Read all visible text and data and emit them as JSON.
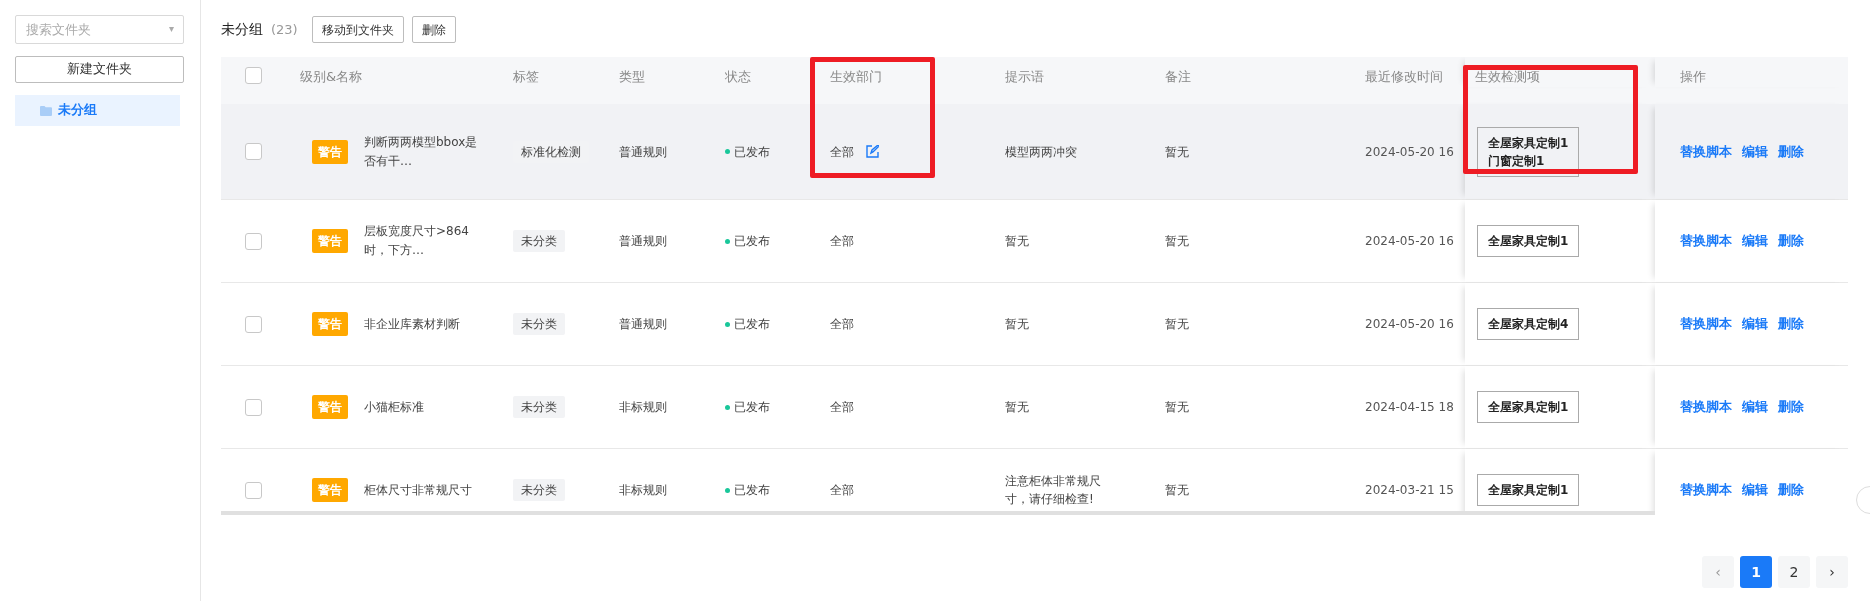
{
  "sidebar": {
    "search": {
      "placeholder": "搜索文件夹",
      "caret": "▾"
    },
    "new_folder_button": "新建文件夹",
    "folders": [
      {
        "label": "未分组",
        "selected": true
      }
    ]
  },
  "toolbar": {
    "title": "未分组",
    "count": "(23)",
    "buttons": [
      "移动到文件夹",
      "删除"
    ]
  },
  "table": {
    "select_all_checked": false,
    "columns": [
      {
        "label": "级别&名称",
        "highlighted": false
      },
      {
        "label": "标签",
        "highlighted": false
      },
      {
        "label": "类型",
        "highlighted": false
      },
      {
        "label": "状态",
        "highlighted": false
      },
      {
        "label": "生效部门",
        "highlighted": true
      },
      {
        "label": "提示语",
        "highlighted": false
      },
      {
        "label": "备注",
        "highlighted": false
      },
      {
        "label": "最近修改时间",
        "highlighted": false
      },
      {
        "label": "生效检测项",
        "highlighted": true
      },
      {
        "label": "操作",
        "highlighted": false
      }
    ],
    "rows": [
      {
        "checked": false,
        "hovered": true,
        "level": "警告",
        "name": "判断两两模型bbox是否有干…",
        "tag": "标准化检测",
        "type": "普通规则",
        "status": "已发布",
        "department": "全部",
        "department_editable": true,
        "tip": "模型两两冲突",
        "note": "暂无",
        "time": "2024-05-20 16",
        "detect_items": [
          "全屋家具定制1",
          "门窗定制1"
        ],
        "actions": [
          "替换脚本",
          "编辑",
          "删除"
        ]
      },
      {
        "checked": false,
        "hovered": false,
        "level": "警告",
        "name": "层板宽度尺寸>864时，下方…",
        "tag": "未分类",
        "type": "普通规则",
        "status": "已发布",
        "department": "全部",
        "department_editable": false,
        "tip": "暂无",
        "note": "暂无",
        "time": "2024-05-20 16",
        "detect_items": [
          "全屋家具定制1"
        ],
        "actions": [
          "替换脚本",
          "编辑",
          "删除"
        ]
      },
      {
        "checked": false,
        "hovered": false,
        "level": "警告",
        "name": "非企业库素材判断",
        "tag": "未分类",
        "type": "普通规则",
        "status": "已发布",
        "department": "全部",
        "department_editable": false,
        "tip": "暂无",
        "note": "暂无",
        "time": "2024-05-20 16",
        "detect_items": [
          "全屋家具定制4"
        ],
        "actions": [
          "替换脚本",
          "编辑",
          "删除"
        ]
      },
      {
        "checked": false,
        "hovered": false,
        "level": "警告",
        "name": "小猫柜标准",
        "tag": "未分类",
        "type": "非标规则",
        "status": "已发布",
        "department": "全部",
        "department_editable": false,
        "tip": "暂无",
        "note": "暂无",
        "time": "2024-04-15 18",
        "detect_items": [
          "全屋家具定制1"
        ],
        "actions": [
          "替换脚本",
          "编辑",
          "删除"
        ]
      },
      {
        "checked": false,
        "hovered": false,
        "level": "警告",
        "name": "柜体尺寸非常规尺寸",
        "tag": "未分类",
        "type": "非标规则",
        "status": "已发布",
        "department": "全部",
        "department_editable": false,
        "tip": "注意柜体非常规尺寸，请仔细检查!",
        "note": "暂无",
        "time": "2024-03-21 15",
        "detect_items": [
          "全屋家具定制1"
        ],
        "actions": [
          "替换脚本",
          "编辑",
          "删除"
        ]
      }
    ]
  },
  "pagination": {
    "prev": "‹",
    "prev_disabled": true,
    "pages": [
      {
        "label": "1",
        "selected": true
      },
      {
        "label": "2",
        "selected": false
      }
    ],
    "next": "›"
  }
}
